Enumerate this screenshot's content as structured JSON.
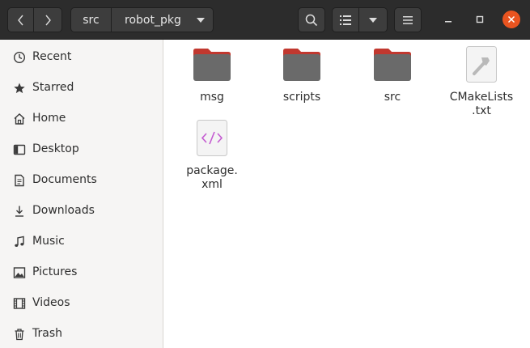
{
  "header": {
    "breadcrumb": [
      {
        "label": "src"
      },
      {
        "label": "robot_pkg"
      }
    ]
  },
  "sidebar": {
    "items": [
      {
        "label": "Recent",
        "icon": "clock-icon"
      },
      {
        "label": "Starred",
        "icon": "star-icon"
      },
      {
        "label": "Home",
        "icon": "home-icon"
      },
      {
        "label": "Desktop",
        "icon": "desktop-icon"
      },
      {
        "label": "Documents",
        "icon": "document-icon"
      },
      {
        "label": "Downloads",
        "icon": "download-icon"
      },
      {
        "label": "Music",
        "icon": "music-icon"
      },
      {
        "label": "Pictures",
        "icon": "picture-icon"
      },
      {
        "label": "Videos",
        "icon": "video-icon"
      },
      {
        "label": "Trash",
        "icon": "trash-icon"
      }
    ]
  },
  "files": [
    {
      "name": "msg",
      "type": "folder"
    },
    {
      "name": "scripts",
      "type": "folder"
    },
    {
      "name": "src",
      "type": "folder"
    },
    {
      "name": "CMakeLists\n.txt",
      "type": "text-file"
    },
    {
      "name": "package.\nxml",
      "type": "xml-file"
    }
  ],
  "colors": {
    "headerbar": "#2c2c2c",
    "sidebar": "#f6f5f4",
    "folder_tab": "#e95420",
    "folder_body": "#6a6a6a",
    "close_button": "#e95420",
    "desktop_background": "#3a1130"
  }
}
